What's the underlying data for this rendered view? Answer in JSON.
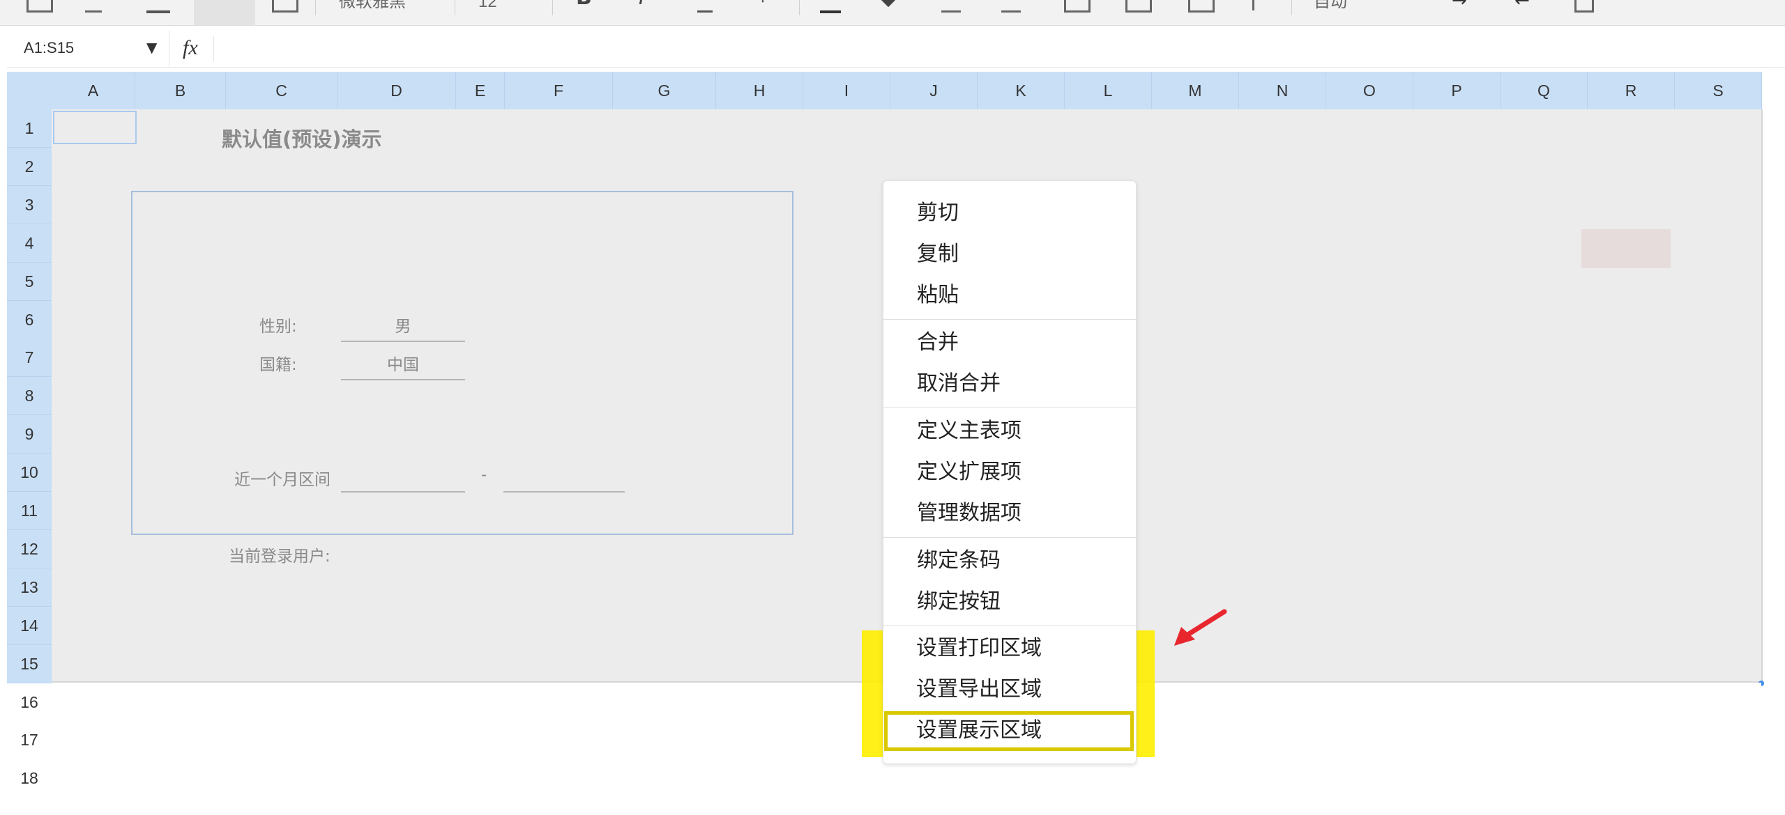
{
  "toolbar": {
    "font_name": "微软雅黑",
    "font_size": "12",
    "auto_label": "自动"
  },
  "formula_bar": {
    "name_box": "A1:S15",
    "dropdown_glyph": "▼",
    "fx_label": "fx",
    "formula_value": ""
  },
  "columns": [
    "A",
    "B",
    "C",
    "D",
    "E",
    "F",
    "G",
    "H",
    "I",
    "J",
    "K",
    "L",
    "M",
    "N",
    "O",
    "P",
    "Q",
    "R",
    "S"
  ],
  "rows": [
    "1",
    "2",
    "3",
    "4",
    "5",
    "6",
    "7",
    "8",
    "9",
    "10",
    "11",
    "12",
    "13",
    "14",
    "15",
    "16",
    "17",
    "18"
  ],
  "sheet": {
    "title": "默认值(预设)演示",
    "gender_label": "性别:",
    "gender_value": "男",
    "nationality_label": "国籍:",
    "nationality_value": "中国",
    "month_range_label": "近一个月区间",
    "range_separator": "-",
    "current_user_label": "当前登录用户:"
  },
  "context_menu": {
    "items": [
      {
        "label": "剪切"
      },
      {
        "label": "复制"
      },
      {
        "label": "粘贴"
      },
      {
        "label": "合并"
      },
      {
        "label": "取消合并"
      },
      {
        "label": "定义主表项"
      },
      {
        "label": "定义扩展项"
      },
      {
        "label": "管理数据项"
      },
      {
        "label": "绑定条码"
      },
      {
        "label": "绑定按钮"
      },
      {
        "label": "设置打印区域"
      },
      {
        "label": "设置导出区域"
      },
      {
        "label": "设置展示区域"
      }
    ]
  },
  "colors": {
    "header_bg": "#c9dff6",
    "selection_bg": "#ececec",
    "highlight": "#ffee00",
    "annotation_arrow": "#e8262d"
  },
  "icons": [
    "save-icon",
    "open-icon",
    "download-icon",
    "table-icon",
    "grid-icon",
    "bold-icon",
    "italic-icon",
    "underline-icon",
    "brush-icon",
    "font-color-icon",
    "fill-color-icon",
    "border-icon",
    "align-icon",
    "merge-icon",
    "insert-icon",
    "image-icon",
    "chart-icon",
    "wrap-icon",
    "indent-icon",
    "outdent-icon",
    "dropdown-icon",
    "fx-icon",
    "red-arrow-annotation"
  ]
}
